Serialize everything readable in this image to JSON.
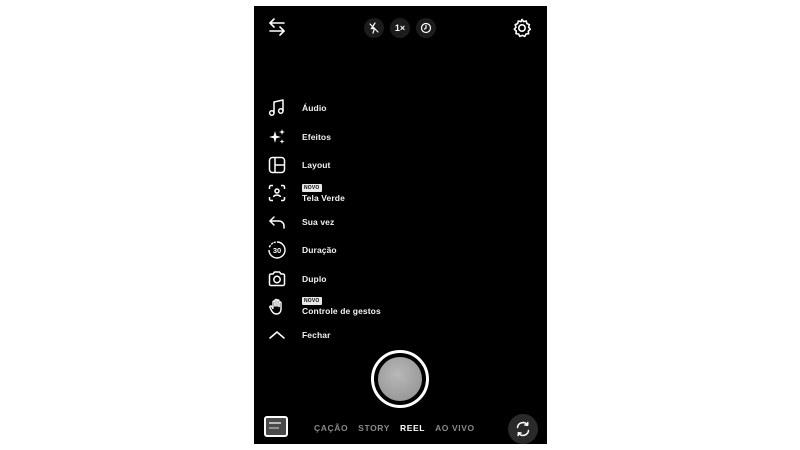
{
  "top_bar": {
    "zoom_label": "1×"
  },
  "menu": {
    "items": [
      {
        "label": "Áudio",
        "icon": "music-note-icon"
      },
      {
        "label": "Efeitos",
        "icon": "sparkles-icon"
      },
      {
        "label": "Layout",
        "icon": "layout-icon"
      },
      {
        "label": "Tela Verde",
        "icon": "green-screen-icon",
        "badge": "NOVO"
      },
      {
        "label": "Sua vez",
        "icon": "reply-arrow-icon"
      },
      {
        "label": "Duração",
        "icon": "timer-30-icon",
        "icon_text": "30"
      },
      {
        "label": "Duplo",
        "icon": "dual-camera-icon"
      },
      {
        "label": "Controle de gestos",
        "icon": "hand-gesture-icon",
        "badge": "NOVO"
      },
      {
        "label": "Fechar",
        "icon": "chevron-up-icon"
      }
    ]
  },
  "modes": {
    "items": [
      "ÇAÇÃO",
      "STORY",
      "REEL",
      "AO VIVO"
    ],
    "active": "REEL"
  },
  "colors": {
    "background": "#000000",
    "text": "#ffffff",
    "inactive_mode": "#8a8a8a"
  }
}
